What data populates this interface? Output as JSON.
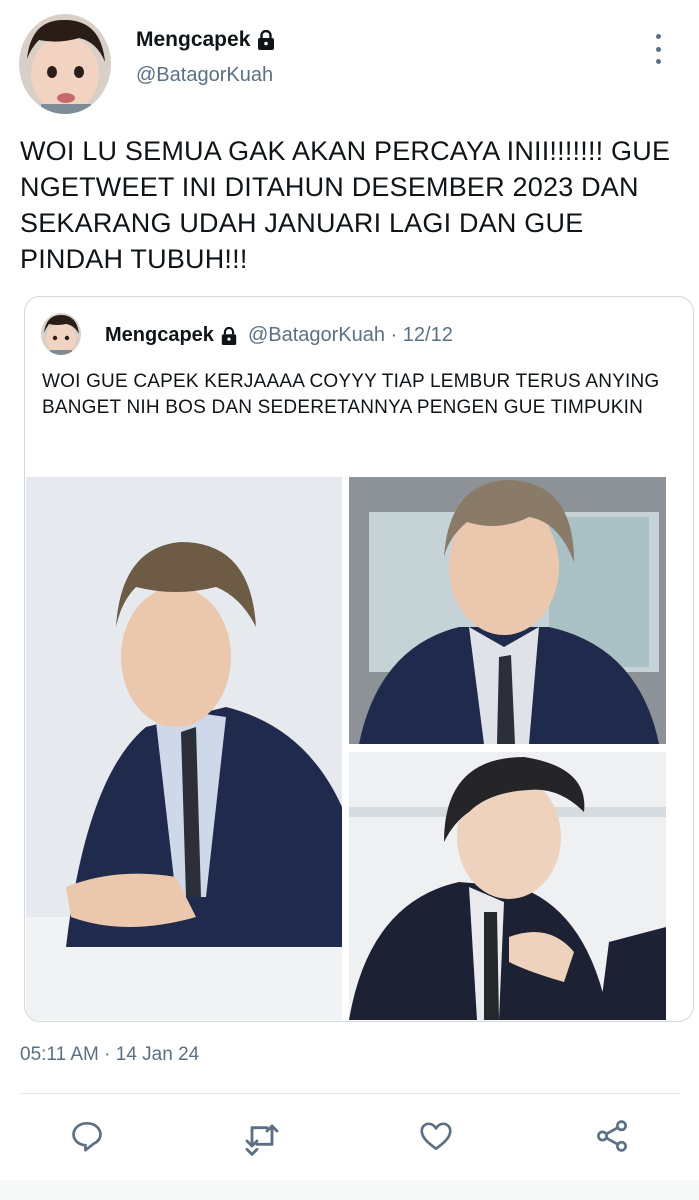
{
  "author": {
    "display_name": "Mengcapek",
    "handle": "@BatagorKuah",
    "avatar_icon": "avatar-photo",
    "protected_icon": "lock-icon"
  },
  "tweet": {
    "text": "WOI LU SEMUA GAK AKAN PERCAYA INII!!!!!!! GUE NGETWEET INI DITAHUN DESEMBER 2023 DAN SEKARANG UDAH JANUARI LAGI DAN GUE PINDAH TUBUH!!!",
    "timestamp": "05:11 AM · 14 Jan 24"
  },
  "quoted_tweet": {
    "display_name": "Mengcapek",
    "handle_and_date": "@BatagorKuah · 12/12",
    "text": "WOI GUE CAPEK KERJAAAA COYYY TIAP LEMBUR TERUS ANYING BANGET NIH BOS DAN SEDERETANNYA PENGEN GUE TIMPUKIN",
    "photos": [
      "photo-man-at-desk",
      "photo-man-window",
      "photo-man-profile"
    ]
  },
  "actions": [
    {
      "name": "reply-button",
      "icon": "reply-icon"
    },
    {
      "name": "retweet-button",
      "icon": "retweet-icon"
    },
    {
      "name": "like-button",
      "icon": "heart-icon"
    },
    {
      "name": "share-button",
      "icon": "share-icon"
    }
  ],
  "colors": {
    "text_primary": "#0f1419",
    "text_secondary": "#5b7083",
    "border": "#cfd9de",
    "suit_navy": "#1f2a4d"
  }
}
